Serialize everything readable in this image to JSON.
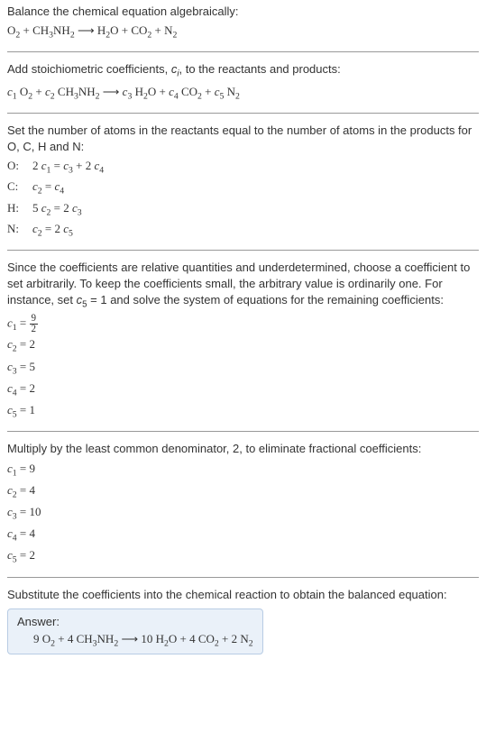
{
  "section1": {
    "title": "Balance the chemical equation algebraically:",
    "equation": "O₂ + CH₃NH₂ ⟶ H₂O + CO₂ + N₂"
  },
  "section2": {
    "text_pre": "Add stoichiometric coefficients, ",
    "var": "cᵢ",
    "text_post": ", to the reactants and products:",
    "equation_parts": {
      "c1": "c₁",
      "r1": " O₂ + ",
      "c2": "c₂",
      "r2": " CH₃NH₂ ⟶ ",
      "c3": "c₃",
      "r3": " H₂O + ",
      "c4": "c₄",
      "r4": " CO₂ + ",
      "c5": "c₅",
      "r5": " N₂"
    }
  },
  "section3": {
    "text": "Set the number of atoms in the reactants equal to the number of atoms in the products for O, C, H and N:",
    "atoms": [
      {
        "label": "O:",
        "eq": "2 c₁ = c₃ + 2 c₄"
      },
      {
        "label": "C:",
        "eq": "c₂ = c₄"
      },
      {
        "label": "H:",
        "eq": "5 c₂ = 2 c₃"
      },
      {
        "label": "N:",
        "eq": "c₂ = 2 c₅"
      }
    ]
  },
  "section4": {
    "text": "Since the coefficients are relative quantities and underdetermined, choose a coefficient to set arbitrarily. To keep the coefficients small, the arbitrary value is ordinarily one. For instance, set c₅ = 1 and solve the system of equations for the remaining coefficients:",
    "coeffs": [
      {
        "label": "c₁ = ",
        "is_frac": true,
        "num": "9",
        "den": "2"
      },
      {
        "label": "c₂ = 2",
        "is_frac": false
      },
      {
        "label": "c₃ = 5",
        "is_frac": false
      },
      {
        "label": "c₄ = 2",
        "is_frac": false
      },
      {
        "label": "c₅ = 1",
        "is_frac": false
      }
    ]
  },
  "section5": {
    "text": "Multiply by the least common denominator, 2, to eliminate fractional coefficients:",
    "coeffs": [
      "c₁ = 9",
      "c₂ = 4",
      "c₃ = 10",
      "c₄ = 4",
      "c₅ = 2"
    ]
  },
  "section6": {
    "text": "Substitute the coefficients into the chemical reaction to obtain the balanced equation:",
    "answer_label": "Answer:",
    "answer_equation": "9 O₂ + 4 CH₃NH₂ ⟶ 10 H₂O + 4 CO₂ + 2 N₂"
  }
}
